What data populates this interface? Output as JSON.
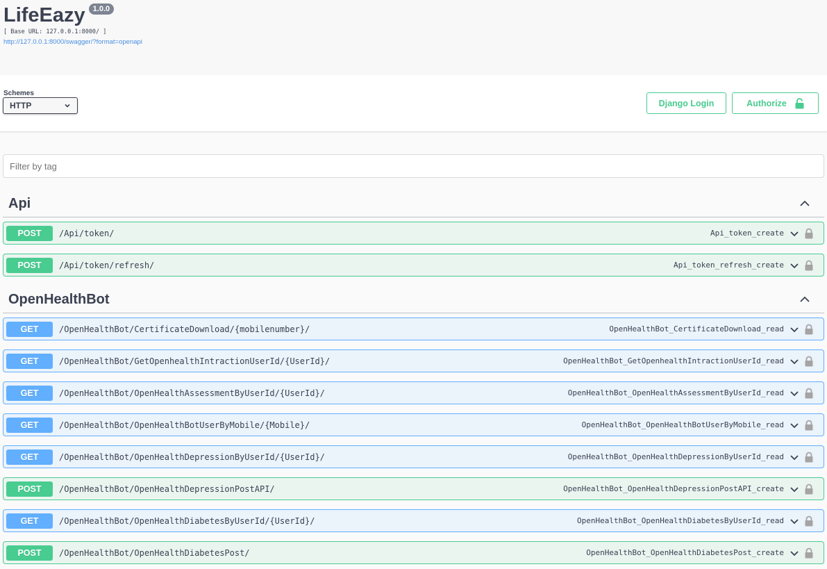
{
  "info": {
    "title": "LifeEazy",
    "version": "1.0.0",
    "base_url": "[ Base URL: 127.0.0.1:8000/ ]",
    "spec_link": "http://127.0.0.1:8000/swagger/?format=openapi"
  },
  "schemes": {
    "label": "Schemes",
    "selected": "HTTP"
  },
  "buttons": {
    "django_login": "Django Login",
    "authorize": "Authorize"
  },
  "filter": {
    "placeholder": "Filter by tag"
  },
  "tags": [
    {
      "name": "Api",
      "operations": [
        {
          "method": "POST",
          "path": "/Api/token/",
          "op_id": "Api_token_create"
        },
        {
          "method": "POST",
          "path": "/Api/token/refresh/",
          "op_id": "Api_token_refresh_create"
        }
      ]
    },
    {
      "name": "OpenHealthBot",
      "operations": [
        {
          "method": "GET",
          "path": "/OpenHealthBot/CertificateDownload/{mobilenumber}/",
          "op_id": "OpenHealthBot_CertificateDownload_read"
        },
        {
          "method": "GET",
          "path": "/OpenHealthBot/GetOpenhealthIntractionUserId/{UserId}/",
          "op_id": "OpenHealthBot_GetOpenhealthIntractionUserId_read"
        },
        {
          "method": "GET",
          "path": "/OpenHealthBot/OpenHealthAssessmentByUserId/{UserId}/",
          "op_id": "OpenHealthBot_OpenHealthAssessmentByUserId_read"
        },
        {
          "method": "GET",
          "path": "/OpenHealthBot/OpenHealthBotUserByMobile/{Mobile}/",
          "op_id": "OpenHealthBot_OpenHealthBotUserByMobile_read"
        },
        {
          "method": "GET",
          "path": "/OpenHealthBot/OpenHealthDepressionByUserId/{UserId}/",
          "op_id": "OpenHealthBot_OpenHealthDepressionByUserId_read"
        },
        {
          "method": "POST",
          "path": "/OpenHealthBot/OpenHealthDepressionPostAPI/",
          "op_id": "OpenHealthBot_OpenHealthDepressionPostAPI_create"
        },
        {
          "method": "GET",
          "path": "/OpenHealthBot/OpenHealthDiabetesByUserId/{UserId}/",
          "op_id": "OpenHealthBot_OpenHealthDiabetesByUserId_read"
        },
        {
          "method": "POST",
          "path": "/OpenHealthBot/OpenHealthDiabetesPost/",
          "op_id": "OpenHealthBot_OpenHealthDiabetesPost_create"
        }
      ]
    }
  ]
}
